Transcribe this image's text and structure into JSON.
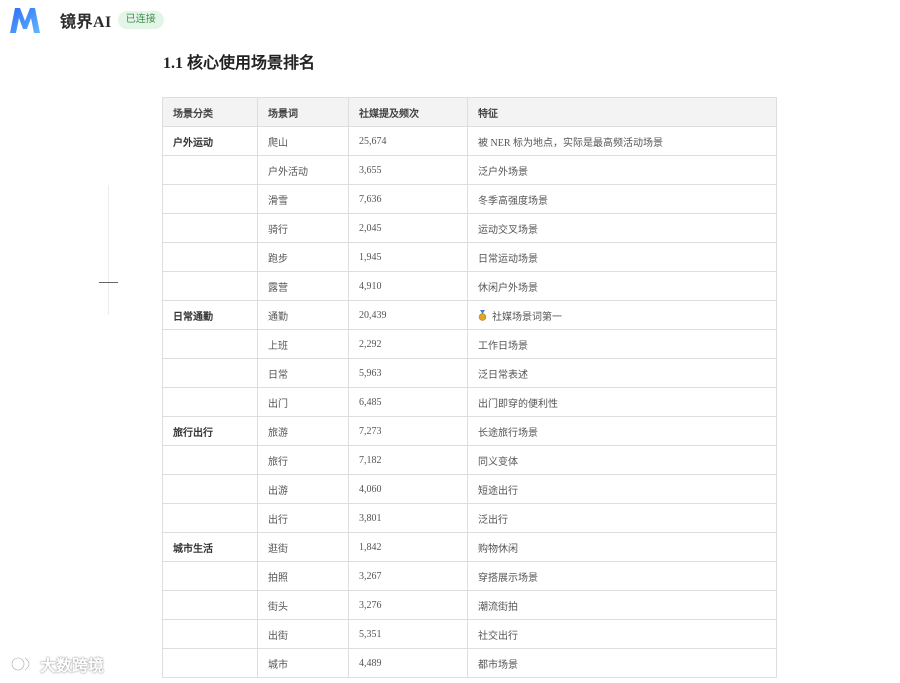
{
  "app": {
    "name": "镜界AI",
    "status_badge": "已连接",
    "brand_color": "#3b82f6"
  },
  "section": {
    "title": "1.1 核心使用场景排名"
  },
  "table": {
    "headers": [
      "场景分类",
      "场景词",
      "社媒提及频次",
      "特征"
    ],
    "rows": [
      {
        "category": "户外运动",
        "word": "爬山",
        "freq": "25,674",
        "feature": "被 NER 标为地点，实际是最高频活动场景"
      },
      {
        "category": "",
        "word": "户外活动",
        "freq": "3,655",
        "feature": "泛户外场景"
      },
      {
        "category": "",
        "word": "滑雪",
        "freq": "7,636",
        "feature": "冬季高强度场景"
      },
      {
        "category": "",
        "word": "骑行",
        "freq": "2,045",
        "feature": "运动交叉场景"
      },
      {
        "category": "",
        "word": "跑步",
        "freq": "1,945",
        "feature": "日常运动场景"
      },
      {
        "category": "",
        "word": "露营",
        "freq": "4,910",
        "feature": "休闲户外场景"
      },
      {
        "category": "日常通勤",
        "word": "通勤",
        "freq": "20,439",
        "feature": "社媒场景词第一",
        "icon": "medal-icon"
      },
      {
        "category": "",
        "word": "上班",
        "freq": "2,292",
        "feature": "工作日场景"
      },
      {
        "category": "",
        "word": "日常",
        "freq": "5,963",
        "feature": "泛日常表述"
      },
      {
        "category": "",
        "word": "出门",
        "freq": "6,485",
        "feature": "出门即穿的便利性"
      },
      {
        "category": "旅行出行",
        "word": "旅游",
        "freq": "7,273",
        "feature": "长途旅行场景"
      },
      {
        "category": "",
        "word": "旅行",
        "freq": "7,182",
        "feature": "同义变体"
      },
      {
        "category": "",
        "word": "出游",
        "freq": "4,060",
        "feature": "短途出行"
      },
      {
        "category": "",
        "word": "出行",
        "freq": "3,801",
        "feature": "泛出行"
      },
      {
        "category": "城市生活",
        "word": "逛街",
        "freq": "1,842",
        "feature": "购物休闲"
      },
      {
        "category": "",
        "word": "拍照",
        "freq": "3,267",
        "feature": "穿搭展示场景"
      },
      {
        "category": "",
        "word": "街头",
        "freq": "3,276",
        "feature": "潮流街拍"
      },
      {
        "category": "",
        "word": "出街",
        "freq": "5,351",
        "feature": "社交出行"
      },
      {
        "category": "",
        "word": "城市",
        "freq": "4,489",
        "feature": "都市场景"
      }
    ]
  },
  "watermark": {
    "text": "大数跨境"
  }
}
